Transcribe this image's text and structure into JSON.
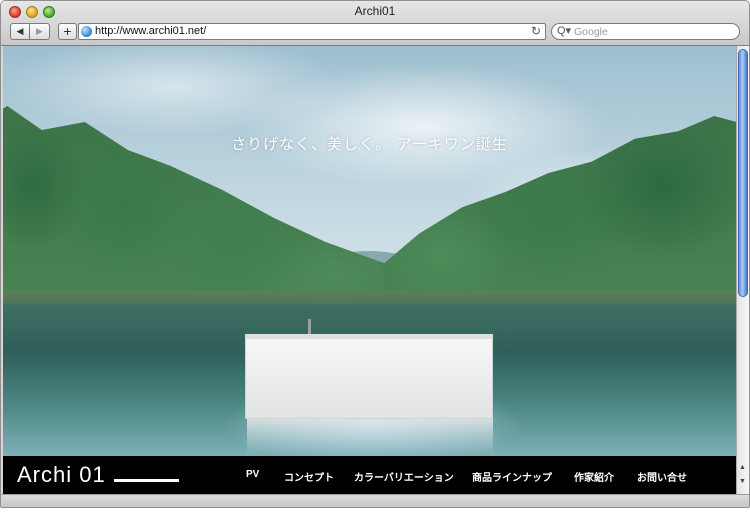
{
  "window": {
    "title": "Archi01"
  },
  "toolbar": {
    "back_glyph": "◀",
    "forward_glyph": "▶",
    "add_glyph": "+",
    "url": "http://www.archi01.net/",
    "reload_glyph": "↻",
    "search_placeholder": "Google",
    "search_glyph": "Q▾"
  },
  "page": {
    "headline": "さりげなく、美しく。 アーキワン誕生",
    "logo": "Archi 01",
    "nav": [
      "PV",
      "コンセプト",
      "カラーバリエーション",
      "商品ラインナップ",
      "作家紹介",
      "お問い合せ"
    ]
  },
  "scrollbar": {
    "up_glyph": "▲",
    "down_glyph": "▼"
  }
}
